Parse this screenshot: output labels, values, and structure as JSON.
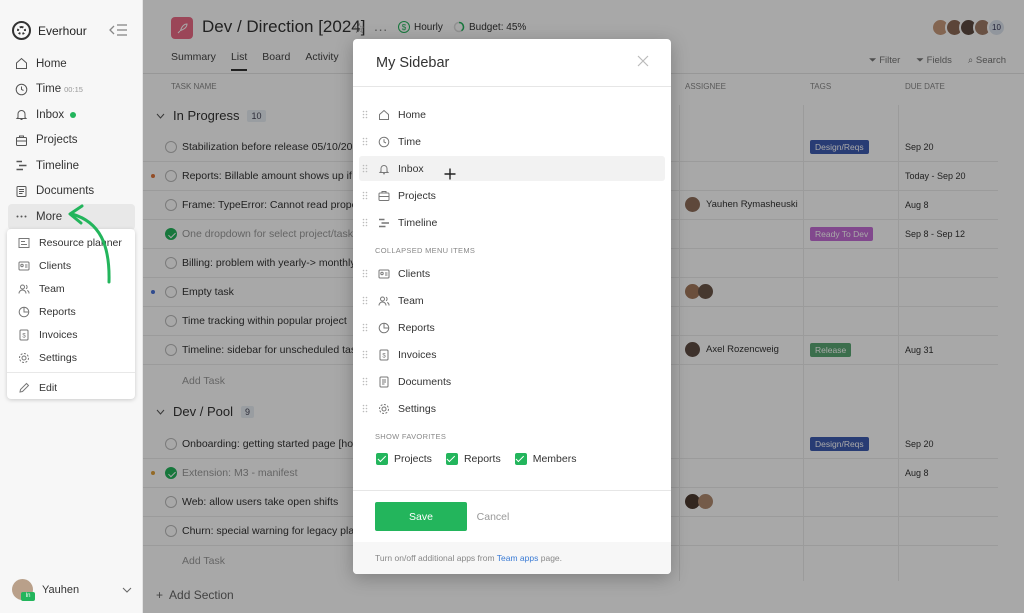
{
  "brand": {
    "name": "Everhour"
  },
  "sidebar": {
    "items": [
      {
        "label": "Home",
        "icon": "home-icon"
      },
      {
        "label": "Time",
        "sub": "00:15",
        "icon": "clock-icon"
      },
      {
        "label": "Inbox",
        "icon": "bell-icon",
        "dot": true
      },
      {
        "label": "Projects",
        "icon": "briefcase-icon"
      },
      {
        "label": "Timeline",
        "icon": "timeline-icon"
      },
      {
        "label": "Documents",
        "icon": "document-icon"
      },
      {
        "label": "More",
        "icon": "ellipsis-icon"
      }
    ],
    "more_menu": [
      {
        "label": "Resource planner",
        "icon": "planner-icon"
      },
      {
        "label": "Clients",
        "icon": "id-card-icon"
      },
      {
        "label": "Team",
        "icon": "users-icon"
      },
      {
        "label": "Reports",
        "icon": "pie-chart-icon"
      },
      {
        "label": "Invoices",
        "icon": "invoice-icon"
      },
      {
        "label": "Settings",
        "icon": "gear-icon"
      }
    ],
    "edit_label": "Edit",
    "user": {
      "name": "Yauhen",
      "badge": "In"
    }
  },
  "project": {
    "title": "Dev / Direction [2024]",
    "billing": "Hourly",
    "budget": "Budget: 45%",
    "team_count": "10"
  },
  "tabs": [
    "Summary",
    "List",
    "Board",
    "Activity"
  ],
  "tools": {
    "filter": "Filter",
    "fields": "Fields",
    "search": "Search"
  },
  "columns": {
    "task": "TASK NAME",
    "assignee": "ASSIGNEE",
    "tags": "TAGS",
    "due": "DUE DATE"
  },
  "sections": [
    {
      "name": "In Progress",
      "count": "10",
      "tasks": [
        {
          "name": "Stabilization before release 05/10/2020",
          "tag": "Design/Reqs",
          "due": "Sep 20"
        },
        {
          "name": "Reports: Billable amount shows up if we",
          "due": "Today - Sep 20"
        },
        {
          "name": "Frame: TypeError: Cannot read propert",
          "assignee": "Yauhen Rymasheuski",
          "due": "Aug 8"
        },
        {
          "name": "One dropdown for select project/task in",
          "tag": "Ready To Dev",
          "due": "Sep 8 - Sep 12"
        },
        {
          "name": "Billing: problem with yearly-> monthly s"
        },
        {
          "name": "Empty task"
        },
        {
          "name": "Time tracking within popular project"
        },
        {
          "name": "Timeline: sidebar for unscheduled tasks",
          "assignee": "Axel Rozencweig",
          "tag": "Release",
          "due": "Aug 31"
        }
      ],
      "add_task": "Add Task"
    },
    {
      "name": "Dev / Pool",
      "count": "9",
      "tasks": [
        {
          "name": "Onboarding: getting started page [hold]",
          "tag": "Design/Reqs",
          "due": "Sep 20"
        },
        {
          "name": "Extension: M3 - manifest",
          "due": "Aug 8"
        },
        {
          "name": "Web: allow users take open shifts"
        },
        {
          "name": "Churn: special warning for legacy plans"
        }
      ],
      "add_task": "Add Task"
    }
  ],
  "add_section": "Add Section",
  "modal": {
    "title": "My Sidebar",
    "items": [
      {
        "label": "Home",
        "icon": "home-icon"
      },
      {
        "label": "Time",
        "icon": "clock-icon"
      },
      {
        "label": "Inbox",
        "icon": "bell-icon"
      },
      {
        "label": "Projects",
        "icon": "briefcase-icon"
      },
      {
        "label": "Timeline",
        "icon": "timeline-icon"
      }
    ],
    "collapsed_heading": "COLLAPSED MENU ITEMS",
    "collapsed_items": [
      {
        "label": "Clients",
        "icon": "id-card-icon"
      },
      {
        "label": "Team",
        "icon": "users-icon"
      },
      {
        "label": "Reports",
        "icon": "pie-chart-icon"
      },
      {
        "label": "Invoices",
        "icon": "invoice-icon"
      },
      {
        "label": "Documents",
        "icon": "document-icon"
      },
      {
        "label": "Settings",
        "icon": "gear-icon"
      }
    ],
    "favorites_heading": "SHOW FAVORITES",
    "favorites": [
      {
        "label": "Projects",
        "checked": true
      },
      {
        "label": "Reports",
        "checked": true
      },
      {
        "label": "Members",
        "checked": true
      }
    ],
    "save_label": "Save",
    "cancel_label": "Cancel",
    "note_prefix": "Turn on/off additional apps from",
    "note_link": "Team apps",
    "note_suffix": "page."
  },
  "colors": {
    "accent": "#23b55c",
    "tag_design": "#3e5bb0",
    "tag_ready": "#c46ed6",
    "tag_release": "#5aa874",
    "project_icon": "#ec6b86"
  }
}
